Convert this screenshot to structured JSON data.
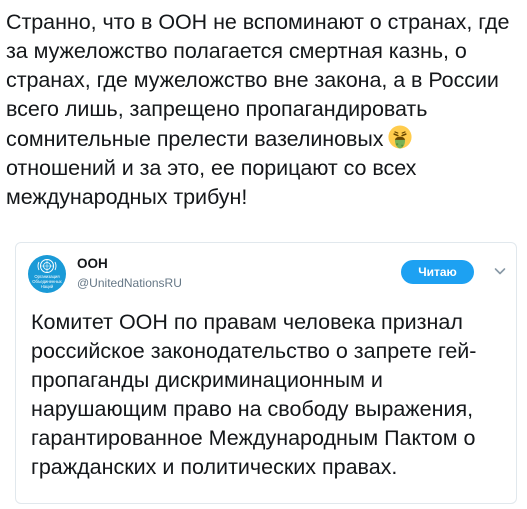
{
  "tweet": {
    "text": "Странно, что в ООН не вспоминают о странах, где за мужеложство полагается смертная казнь, о странах, где мужеложство вне закона, а в России всего лишь, запрещено пропагандировать сомнительные прелести вазелиновых",
    "text_after_emoji": "отношений и за это, ее порицают со всех международных трибун!",
    "emoji": "face-vomiting-icon"
  },
  "quoted": {
    "account_name": "ООН",
    "account_handle": "@UnitedNationsRU",
    "avatar_text": [
      "Организация",
      "Объединенных",
      "Наций"
    ],
    "follow_label": "Читаю",
    "body": "Комитет ООН по правам человека признал российское законодательство о запрете гей-пропаганды дискриминационным и нарушающим право на свободу выражения, гарантированное Международным Пактом о гражданских и политических правах."
  },
  "colors": {
    "text": "#14171a",
    "secondary": "#657786",
    "accent": "#1da1f2",
    "avatar_bg": "#1a9ad7",
    "border": "#e1e8ed"
  }
}
